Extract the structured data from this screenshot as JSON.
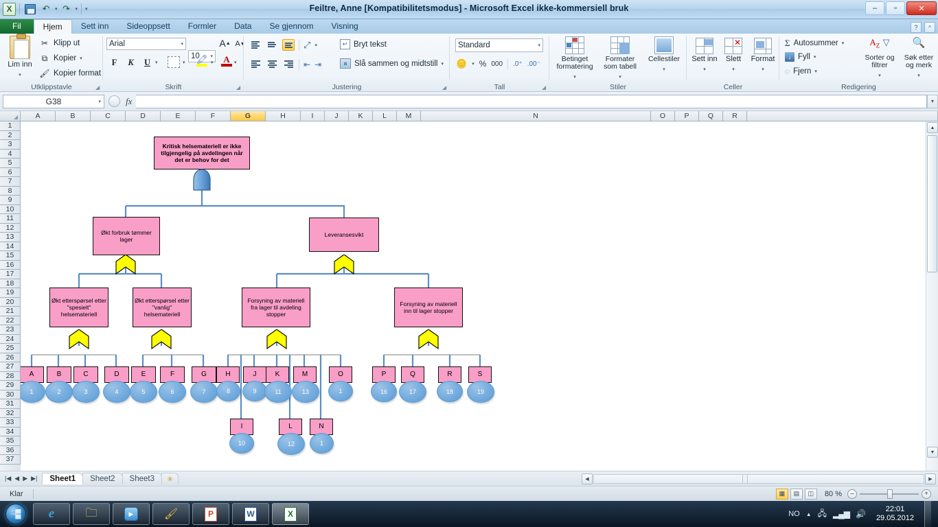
{
  "window": {
    "title": "Feiltre, Anne  [Kompatibilitetsmodus]  -  Microsoft Excel ikke-kommersiell bruk",
    "minimize": "–",
    "maximize": "▫",
    "close": "✕",
    "help": "?",
    "ribbon_min": "^"
  },
  "quick_access": {
    "save": "save-icon",
    "undo": "↰",
    "redo": "↱",
    "customize": "▾"
  },
  "tabs": [
    {
      "label": "Fil",
      "active": false,
      "file": true
    },
    {
      "label": "Hjem",
      "active": true,
      "file": false
    },
    {
      "label": "Sett inn",
      "active": false,
      "file": false
    },
    {
      "label": "Sideoppsett",
      "active": false,
      "file": false
    },
    {
      "label": "Formler",
      "active": false,
      "file": false
    },
    {
      "label": "Data",
      "active": false,
      "file": false
    },
    {
      "label": "Se gjennom",
      "active": false,
      "file": false
    },
    {
      "label": "Visning",
      "active": false,
      "file": false
    }
  ],
  "ribbon": {
    "clipboard": {
      "title": "Utklippstavle",
      "paste": "Lim inn",
      "cut": "Klipp ut",
      "copy": "Kopier",
      "format_painter": "Kopier format"
    },
    "font": {
      "title": "Skrift",
      "font_name": "Arial",
      "font_size": "10",
      "grow": "A",
      "shrink": "A",
      "bold": "F",
      "italic": "K",
      "underline": "U",
      "borders": "borders-icon",
      "fill_color": "fill-color-icon",
      "font_color": "font-color-icon"
    },
    "alignment": {
      "title": "Justering",
      "wrap_text": "Bryt tekst",
      "merge_center": "Slå sammen og midtstill",
      "orientation": "orientation-icon",
      "decrease_indent": "decrease-indent-icon",
      "increase_indent": "increase-indent-icon"
    },
    "number": {
      "title": "Tall",
      "format": "Standard",
      "currency": "currency-icon",
      "percent": "%",
      "thousands": "000",
      "increase_decimal": "increase-decimal-icon",
      "decrease_decimal": "decrease-decimal-icon"
    },
    "styles": {
      "title": "Stiler",
      "conditional": "Betinget formatering",
      "as_table": "Formater som tabell",
      "cell_styles": "Cellestiler"
    },
    "cells": {
      "title": "Celler",
      "insert": "Sett inn",
      "delete": "Slett",
      "format": "Format"
    },
    "editing": {
      "title": "Redigering",
      "autosum": "Autosummer",
      "fill": "Fyll",
      "clear": "Fjern",
      "sort_filter": "Sorter og filtrer",
      "find_select": "Søk etter og merk"
    }
  },
  "formula_bar": {
    "name_box": "G38",
    "formula": "",
    "fx": "fx"
  },
  "grid": {
    "columns": [
      "A",
      "B",
      "C",
      "D",
      "E",
      "F",
      "G",
      "H",
      "I",
      "J",
      "K",
      "L",
      "M",
      "N",
      "O",
      "P",
      "Q",
      "R"
    ],
    "selected_column": "G",
    "rows": [
      1,
      2,
      3,
      4,
      5,
      6,
      7,
      8,
      9,
      10,
      11,
      12,
      13,
      14,
      15,
      16,
      17,
      18,
      19,
      20,
      21,
      22,
      23,
      24,
      25,
      26,
      27,
      28,
      29,
      30,
      31,
      32,
      33,
      34,
      35,
      36,
      37
    ]
  },
  "diagram": {
    "top_event": "Kritisk helsemateriell er ikke tilgjengelig på avdelingen når det er behov for det",
    "level2": [
      "Økt  forbruk tømmer lager",
      "Leveransesvikt"
    ],
    "level3": [
      "Økt etterspørsel etter \"spesielt\" helsemateriell",
      "Økt etterspørsel etter \"vanlig\" helsemateriell",
      "Forsyning av materiell  fra lager til avdeling stopper",
      "Forsyning av materiell inn til lager stopper"
    ],
    "leaves": [
      {
        "letter": "A",
        "number": "1"
      },
      {
        "letter": "B",
        "number": "2"
      },
      {
        "letter": "C",
        "number": "3"
      },
      {
        "letter": "D",
        "number": "4"
      },
      {
        "letter": "E",
        "number": "5"
      },
      {
        "letter": "F",
        "number": "6"
      },
      {
        "letter": "G",
        "number": "7"
      },
      {
        "letter": "H",
        "number": "8"
      },
      {
        "letter": "I",
        "number": "10"
      },
      {
        "letter": "J",
        "number": "9"
      },
      {
        "letter": "K",
        "number": "11"
      },
      {
        "letter": "L",
        "number": "12"
      },
      {
        "letter": "M",
        "number": "13"
      },
      {
        "letter": "N",
        "number": "1"
      },
      {
        "letter": "O",
        "number": "1"
      },
      {
        "letter": "P",
        "number": "16"
      },
      {
        "letter": "Q",
        "number": "17"
      },
      {
        "letter": "R",
        "number": "18"
      },
      {
        "letter": "S",
        "number": "19"
      }
    ],
    "colors": {
      "node_fill": "#f99ec7",
      "circle_fill": "#5b9bd5",
      "gate_fill": "#ffff00",
      "connector": "#5b8fc2"
    }
  },
  "sheets": {
    "items": [
      "Sheet1",
      "Sheet2",
      "Sheet3"
    ],
    "active": "Sheet1",
    "new_sheet": "new-sheet-icon",
    "nav_first": "|◀",
    "nav_prev": "◀",
    "nav_next": "▶",
    "nav_last": "▶|"
  },
  "status": {
    "mode": "Klar",
    "zoom": "80 %",
    "view_normal": "normal-view-icon",
    "view_layout": "page-layout-icon",
    "view_break": "page-break-icon",
    "zoom_out": "–",
    "zoom_in": "+"
  },
  "taskbar": {
    "start": "start-orb",
    "items": [
      "internet-explorer-icon",
      "file-explorer-icon",
      "media-player-icon",
      "paint-icon",
      "powerpoint-icon",
      "word-icon",
      "excel-icon"
    ],
    "language": "NO",
    "tray_expand": "▲",
    "network": "network-icon",
    "signal": "signal-icon",
    "volume": "volume-icon",
    "time": "22:01",
    "date": "29.05.2012"
  }
}
